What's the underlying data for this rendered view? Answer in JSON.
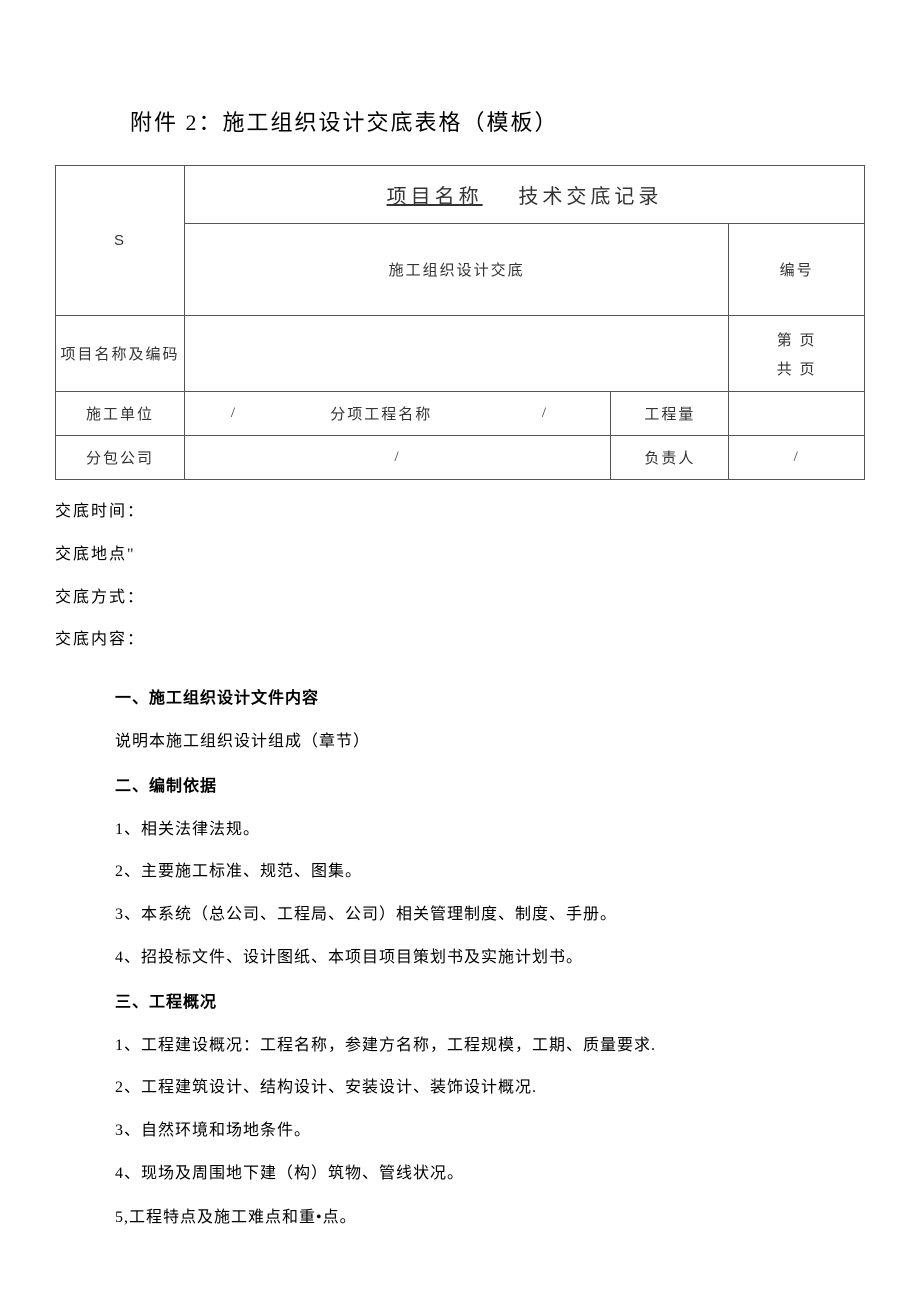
{
  "title": "附件 2：施工组织设计交底表格（模板）",
  "logo_glyph": "S",
  "header": {
    "project_label": "项目名称",
    "record_label": "技术交底记录",
    "subtitle": "施工组织设计交底",
    "serial_label": "编号"
  },
  "row_project": {
    "label": "项目名称及编码",
    "value": "",
    "page_curr_label": "第 页",
    "page_total_label": "共 页"
  },
  "row_unit": {
    "label": "施工单位",
    "slash1": "/",
    "sub_label": "分项工程名称",
    "slash2": "/",
    "qty_label": "工程量",
    "qty_value": ""
  },
  "row_subco": {
    "label": "分包公司",
    "value": "/",
    "owner_label": "负责人",
    "owner_value": "/"
  },
  "content_lines": {
    "time": "交底时间：",
    "place": "交底地点\"",
    "mode": "交底方式：",
    "body": "交底内容："
  },
  "sections": [
    {
      "t": "h",
      "text": "一、施工组织设计文件内容"
    },
    {
      "t": "p",
      "text": "说明本施工组织设计组成（章节）"
    },
    {
      "t": "h",
      "text": "二、编制依据"
    },
    {
      "t": "p",
      "text": "1、相关法律法规。"
    },
    {
      "t": "p",
      "text": "2、主要施工标准、规范、图集。"
    },
    {
      "t": "p",
      "text": "3、本系统（总公司、工程局、公司）相关管理制度、制度、手册。"
    },
    {
      "t": "p",
      "text": "4、招投标文件、设计图纸、本项目项目策划书及实施计划书。"
    },
    {
      "t": "h",
      "text": "三、工程概况"
    },
    {
      "t": "p",
      "text": "1、工程建设概况：工程名称，参建方名称，工程规模，工期、质量要求."
    },
    {
      "t": "p",
      "text": "2、工程建筑设计、结构设计、安装设计、装饰设计概况."
    },
    {
      "t": "p",
      "text": "3、自然环境和场地条件。"
    },
    {
      "t": "p",
      "text": "4、现场及周围地下建（构）筑物、管线状况。"
    }
  ],
  "after_note": "5,工程特点及施工难点和重•点。"
}
